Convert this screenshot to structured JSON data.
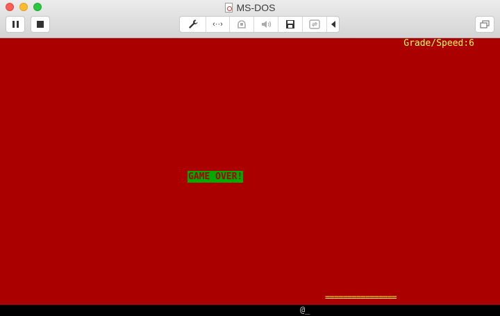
{
  "window": {
    "title": "MS-DOS"
  },
  "toolbar": {
    "left_buttons": [
      {
        "name": "pause-button",
        "icon": "pause-icon"
      },
      {
        "name": "stop-button",
        "icon": "stop-icon"
      }
    ],
    "center_buttons": [
      {
        "name": "settings-button",
        "icon": "wrench-icon"
      },
      {
        "name": "network-button",
        "icon": "network-arrows-icon",
        "glyph": "‹··›"
      },
      {
        "name": "device-button",
        "icon": "device-icon",
        "disabled": true
      },
      {
        "name": "sound-button",
        "icon": "speaker-icon",
        "disabled": true
      },
      {
        "name": "save-button",
        "icon": "floppy-icon"
      },
      {
        "name": "sync-button",
        "icon": "sync-icon",
        "disabled": true
      },
      {
        "name": "collapse-button",
        "icon": "triangle-left-icon"
      }
    ],
    "right_buttons": [
      {
        "name": "window-mode-button",
        "icon": "windows-icon"
      }
    ]
  },
  "game": {
    "grade_speed": "Grade/Speed:6",
    "game_over": "GAME OVER!",
    "paddle": "================",
    "prompt": "@_"
  },
  "colors": {
    "background": "#aa0000",
    "text_yellow": "#ffff55",
    "gameover_bg": "#00aa00",
    "gameover_text": "#aa0000"
  }
}
